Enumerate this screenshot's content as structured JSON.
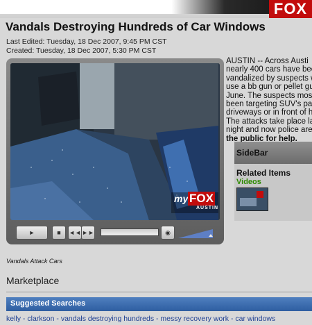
{
  "brand": {
    "logo": "FOX"
  },
  "headline": "Vandals Destroying Hundreds of Car Windows",
  "last_edited": "Last Edited: Tuesday, 18 Dec 2007, 9:45 PM CST",
  "created": "Created: Tuesday, 18 Dec 2007, 5:30 PM CST",
  "video": {
    "watermark_top": "my",
    "watermark_fox": "FOX",
    "watermark_city": "AUSTIN",
    "controls": {
      "play": "►",
      "stop": "■",
      "rewind": "◄◄",
      "forward": "►►",
      "volume": "◉"
    }
  },
  "caption": "Vandals Attack Cars",
  "article_lines": [
    "AUSTIN -- Across Austi",
    "nearly 400 cars have bee",
    "vandalized by suspects w",
    "use a bb gun or pellet gu",
    "June. The suspects most",
    "been targeting SUV's pa",
    "driveways or in front of h",
    "The attacks take place la",
    "night and now police are"
  ],
  "article_bold": "the public for help.",
  "sidebar": {
    "title": "SideBar",
    "related_title": "Related Items",
    "videos_label": "Videos"
  },
  "marketplace": "Marketplace",
  "suggested_searches": {
    "title": "Suggested Searches",
    "links": [
      "kelly",
      "clarkson",
      "vandals destroying hundreds",
      "messy recovery work",
      "car windows"
    ],
    "separator": " - "
  },
  "colors": {
    "fox_red": "#c20c0c",
    "link_blue": "#1d3f93",
    "video_green": "#2e8b00",
    "bar_blue": "#2e5ea1"
  }
}
